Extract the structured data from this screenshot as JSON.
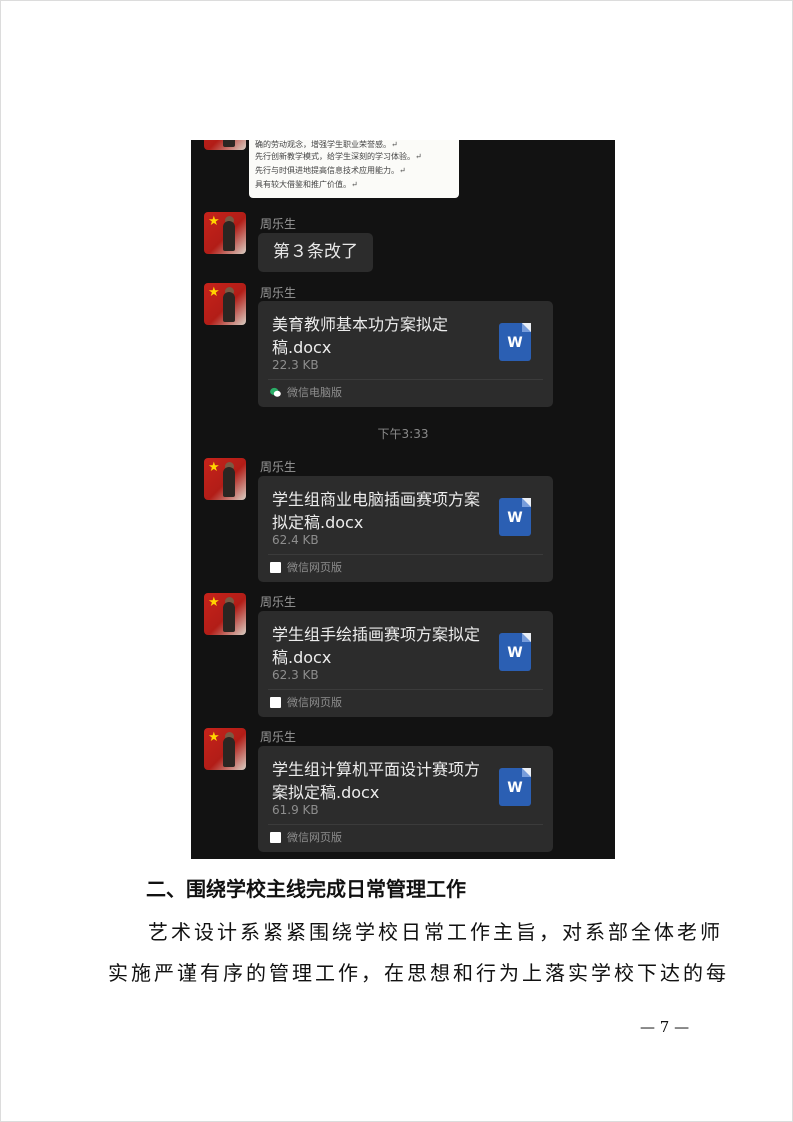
{
  "chat": {
    "doc_preview_lines": [
      "确的劳动观念，增强学生职业荣誉感。↵",
      "先行创新教学模式，给学生深刻的学习体验。↵",
      "先行与时俱进地提高信息技术应用能力。↵",
      "具有较大借鉴和推广价值。↵"
    ],
    "messages": [
      {
        "sender": "周乐生",
        "text": "第３条改了"
      },
      {
        "sender": "周乐生",
        "file_name": "美育教师基本功方案拟定稿.docx",
        "file_size": "22.3 KB",
        "source": "微信电脑版",
        "source_icon": "wechat-icon"
      },
      {
        "sender": "周乐生",
        "file_name": "学生组商业电脑插画赛项方案拟定稿.docx",
        "file_size": "62.4 KB",
        "source": "微信网页版",
        "source_icon": "square-icon"
      },
      {
        "sender": "周乐生",
        "file_name": "学生组手绘插画赛项方案拟定稿.docx",
        "file_size": "62.3 KB",
        "source": "微信网页版",
        "source_icon": "square-icon"
      },
      {
        "sender": "周乐生",
        "file_name": "学生组计算机平面设计赛项方案拟定稿.docx",
        "file_size": "61.9 KB",
        "source": "微信网页版",
        "source_icon": "square-icon"
      }
    ],
    "timestamp": "下午3:33",
    "file_icon_letter": "W",
    "colors": {
      "background": "#121212",
      "bubble": "#2c2c2c",
      "word_icon": "#2b5fb3",
      "wechat_green": "#2aae67"
    }
  },
  "document": {
    "heading": "二、围绕学校主线完成日常管理工作",
    "paragraph_lines": [
      "艺术设计系紧紧围绕学校日常工作主旨，对系部全体老师",
      "实施严谨有序的管理工作，在思想和行为上落实学校下达的每"
    ],
    "page_number": "— 7 —"
  }
}
